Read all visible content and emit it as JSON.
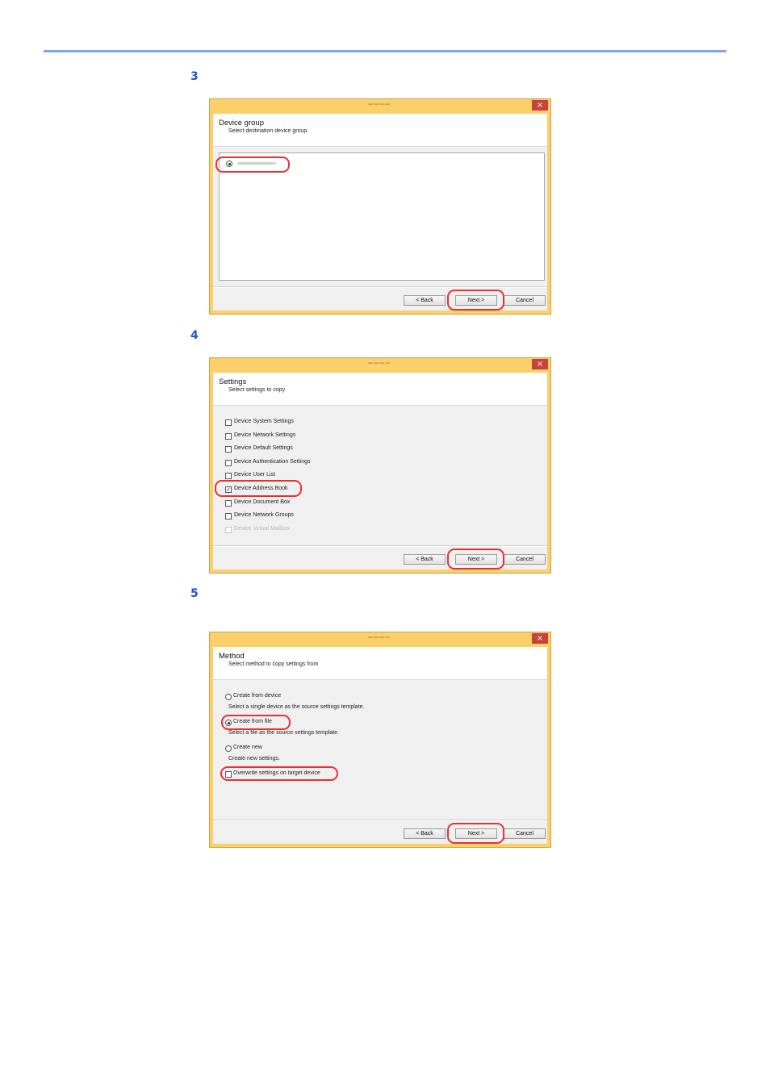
{
  "steps": [
    "3",
    "4",
    "5"
  ],
  "dialog1": {
    "header_title": "Device group",
    "header_subtitle": "Select destination device group",
    "back": "< Back",
    "next": "Next >",
    "cancel": "Cancel",
    "close_glyph": "×"
  },
  "dialog2": {
    "header_title": "Settings",
    "header_subtitle": "Select settings to copy",
    "options": [
      {
        "label": "Device System Settings",
        "checked": false
      },
      {
        "label": "Device Network Settings",
        "checked": false
      },
      {
        "label": "Device Default Settings",
        "checked": false
      },
      {
        "label": "Device Authentication Settings",
        "checked": false
      },
      {
        "label": "Device User List",
        "checked": false
      },
      {
        "label": "Device Address Book",
        "checked": true
      },
      {
        "label": "Device Document Box",
        "checked": false
      },
      {
        "label": "Device Network Groups",
        "checked": false
      },
      {
        "label": "Device Virtual Mailbox",
        "checked": false,
        "disabled": true
      }
    ],
    "check_glyph": "✓",
    "back": "< Back",
    "next": "Next >",
    "cancel": "Cancel",
    "close_glyph": "×"
  },
  "dialog3": {
    "header_title": "Method",
    "header_subtitle": "Select method to copy settings from",
    "create_from_device": "Create from device",
    "create_from_device_desc": "Select a single device as the source settings template.",
    "create_from_file": "Create from file",
    "create_from_file_desc": "Select a file as the source settings template.",
    "create_new": "Create new",
    "create_new_desc": "Create new settings.",
    "overwrite": "Overwrite settings on target device",
    "back": "< Back",
    "next": "Next >",
    "cancel": "Cancel",
    "close_glyph": "×"
  },
  "colors": {
    "accent_rule": "#7fa7e8",
    "step_number": "#1a53d6",
    "window_frame": "#fbcf69",
    "highlight": "#e8312f",
    "close_button": "#c9423a"
  }
}
